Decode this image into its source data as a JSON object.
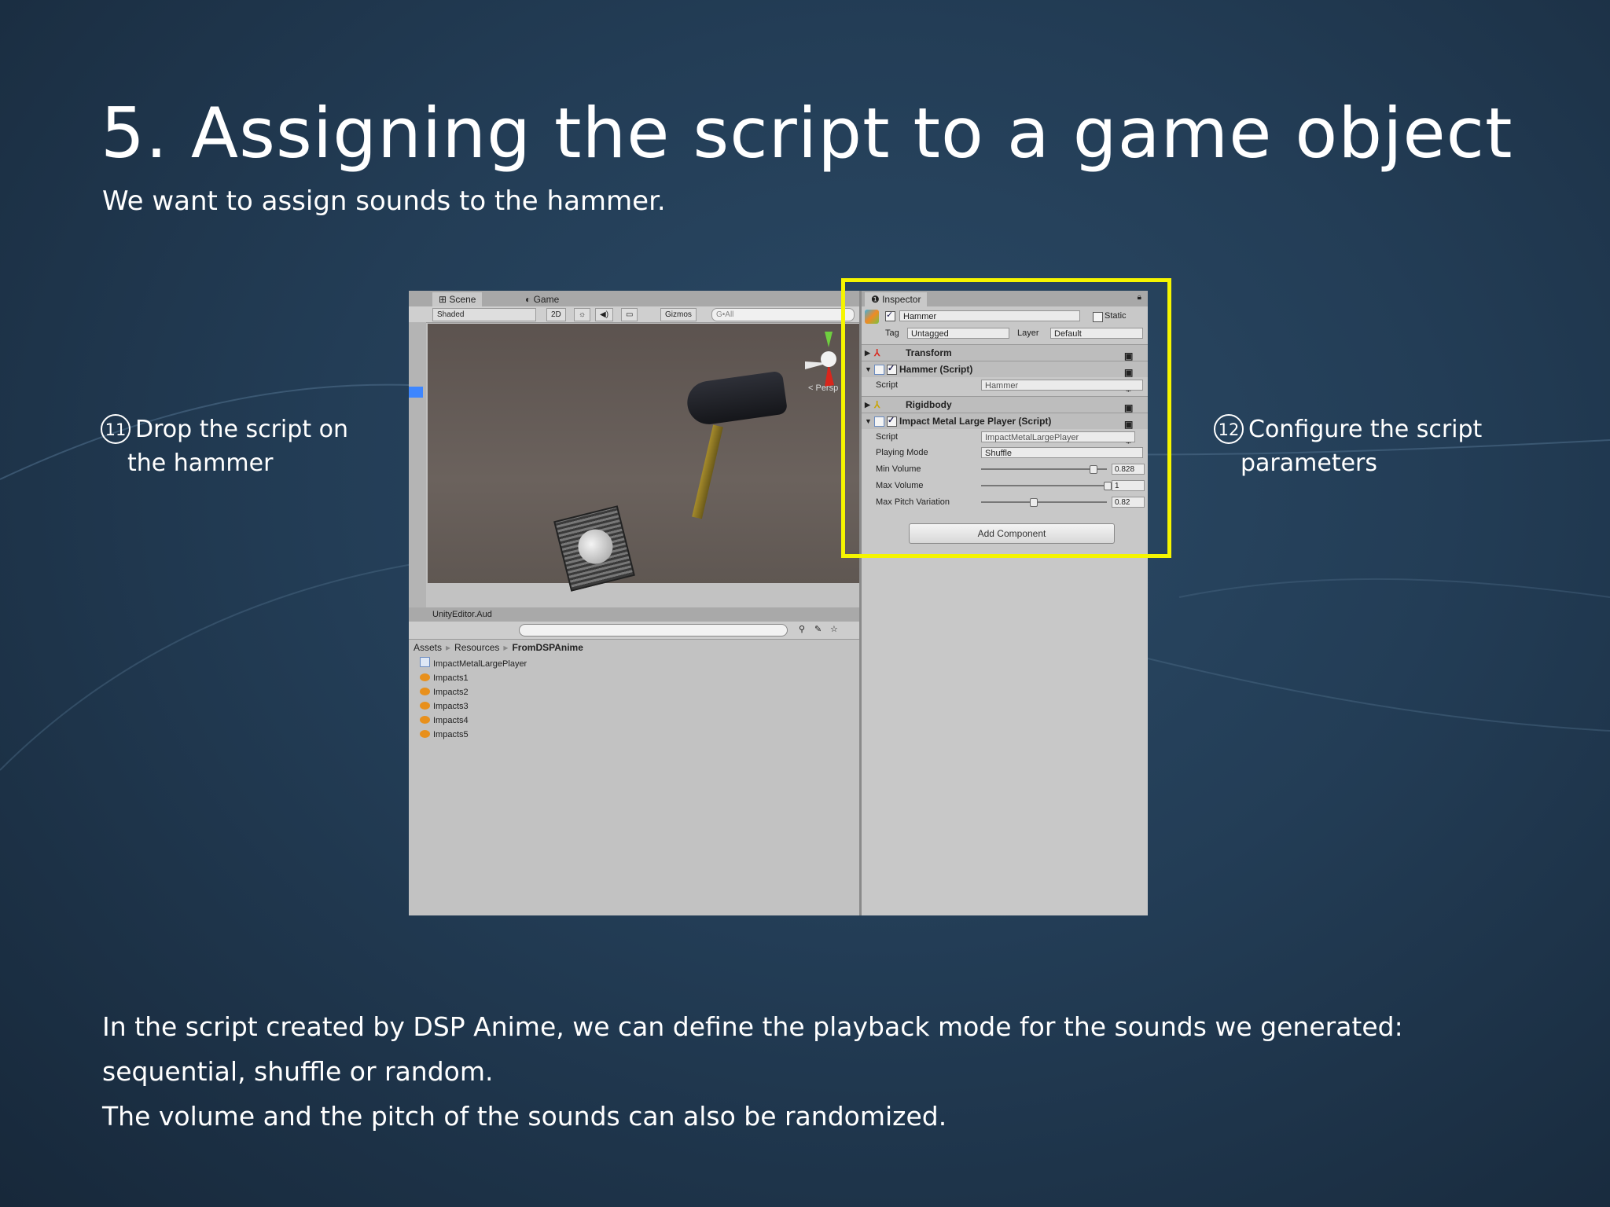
{
  "slide": {
    "title": "5. Assigning the script to a game object",
    "subtitle": "We want to assign sounds to the hammer.",
    "callout_left": {
      "number": "11",
      "line1": "Drop the script on",
      "line2": "the hammer"
    },
    "callout_right": {
      "number": "12",
      "line1": "Configure the script",
      "line2": "parameters"
    },
    "body": [
      "In the script created by DSP Anime, we can define the playback mode for the sounds we generated:",
      "sequential, shuffle or random.",
      "The volume and the pitch of the sounds can also be randomized."
    ],
    "highlight_color": "#f5f500"
  },
  "editor": {
    "scene_view": {
      "tabs": [
        "Scene",
        "Game"
      ],
      "shading": "Shaded",
      "mode_2d": "2D",
      "gizmos": "Gizmos",
      "search_placeholder": "G•All",
      "persp_label": "< Persp"
    },
    "project": {
      "window_title": "UnityEditor.Aud",
      "breadcrumb": [
        "Assets",
        "Resources",
        "FromDSPAnime"
      ],
      "assets": [
        {
          "name": "ImpactMetalLargePlayer",
          "icon": "script-icon"
        },
        {
          "name": "Impacts1",
          "icon": "audio-clip-icon"
        },
        {
          "name": "Impacts2",
          "icon": "audio-clip-icon"
        },
        {
          "name": "Impacts3",
          "icon": "audio-clip-icon"
        },
        {
          "name": "Impacts4",
          "icon": "audio-clip-icon"
        },
        {
          "name": "Impacts5",
          "icon": "audio-clip-icon"
        }
      ]
    },
    "inspector": {
      "tab": "Inspector",
      "object_name": "Hammer",
      "static_label": "Static",
      "tag_label": "Tag",
      "tag_value": "Untagged",
      "layer_label": "Layer",
      "layer_value": "Default",
      "components": {
        "transform": "Transform",
        "hammer_script": "Hammer (Script)",
        "hammer_script_field_label": "Script",
        "hammer_script_field_value": "Hammer",
        "rigidbody": "Rigidbody",
        "impact_player": "Impact Metal Large Player (Script)",
        "impact_script_label": "Script",
        "impact_script_value": "ImpactMetalLargePlayer",
        "playing_mode_label": "Playing Mode",
        "playing_mode_value": "Shuffle",
        "min_volume_label": "Min Volume",
        "min_volume_value": "0.828",
        "max_volume_label": "Max Volume",
        "max_volume_value": "1",
        "max_pitch_label": "Max Pitch Variation",
        "max_pitch_value": "0.82"
      },
      "add_component": "Add Component"
    }
  }
}
